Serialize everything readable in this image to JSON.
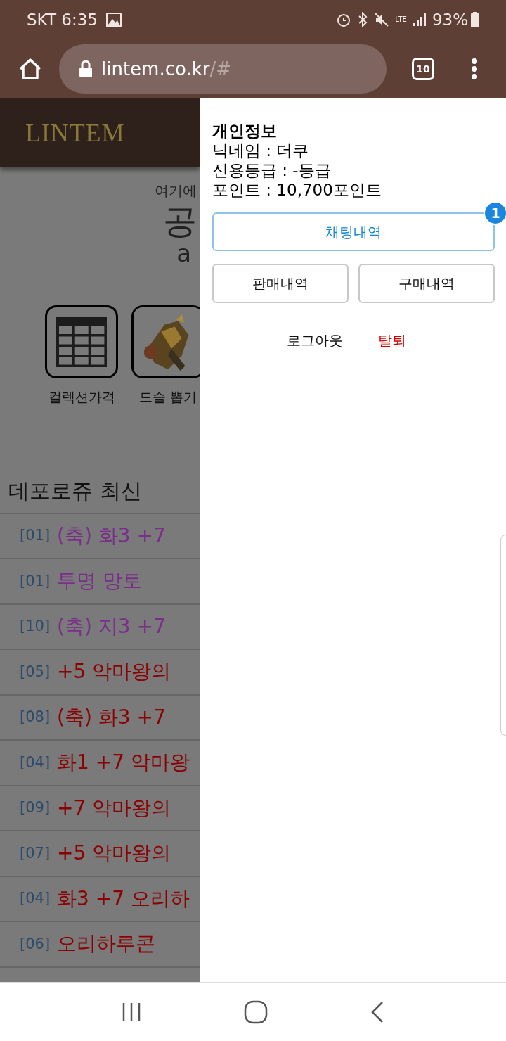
{
  "status_bar": {
    "carrier_time": "SKT 6:35",
    "network": "LTE",
    "battery": "93%"
  },
  "address_bar": {
    "host": "lintem.co.kr",
    "path": "/#",
    "tab_count": "10"
  },
  "site": {
    "logo": "LINTEM",
    "intro": "여기에",
    "headline": "공",
    "subline": "a",
    "shortcuts": [
      {
        "kind": "table",
        "label": "컬렉션가격"
      },
      {
        "kind": "picture",
        "label": "드슬 뽑기"
      }
    ],
    "list_title": "데포로쥬 최신",
    "items": [
      {
        "index": "[01]",
        "name": "(축) 화3 +7",
        "color": "#7b2d8b"
      },
      {
        "index": "[01]",
        "name": "투명 망토",
        "color": "#7b2d8b"
      },
      {
        "index": "[10]",
        "name": "(축) 지3 +7",
        "color": "#7b2d8b"
      },
      {
        "index": "[05]",
        "name": "+5 악마왕의",
        "color": "#8b0000"
      },
      {
        "index": "[08]",
        "name": "(축) 화3 +7",
        "color": "#8b0000"
      },
      {
        "index": "[04]",
        "name": "화1 +7 악마왕",
        "color": "#8b0000"
      },
      {
        "index": "[09]",
        "name": "+7 악마왕의",
        "color": "#8b0000"
      },
      {
        "index": "[07]",
        "name": "+5 악마왕의",
        "color": "#8b0000"
      },
      {
        "index": "[04]",
        "name": "화3 +7 오리하",
        "color": "#8b0000"
      },
      {
        "index": "[06]",
        "name": "오리하루콘",
        "color": "#8b0000"
      }
    ]
  },
  "drawer": {
    "title": "개인정보",
    "lines": [
      "닉네임 : 더쿠",
      "신용등급 : -등급",
      "포인트 : 10,700포인트"
    ],
    "chat_button": {
      "label": "채팅내역",
      "badge": "1"
    },
    "buttons": [
      "판매내역",
      "구매내역"
    ],
    "logout": "로그아웃",
    "withdraw": "탈퇴"
  }
}
